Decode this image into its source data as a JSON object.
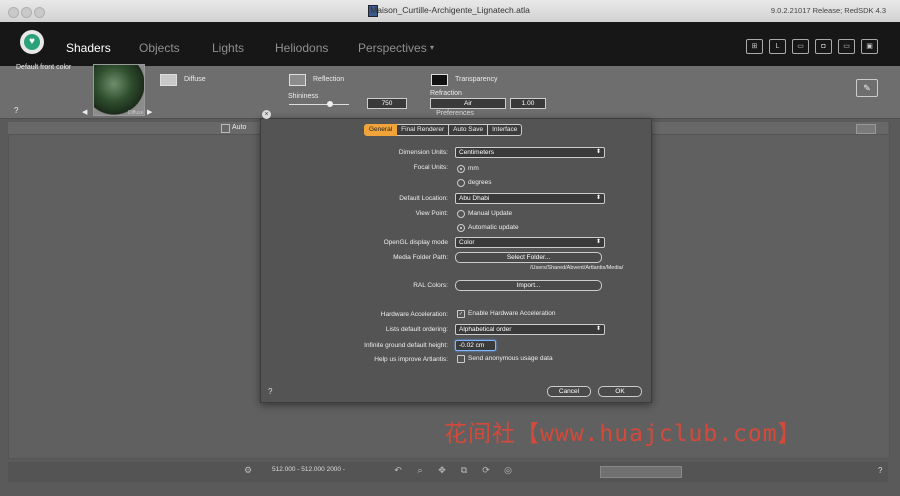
{
  "window": {
    "title": "Maison_Curtille-Archigente_Lignatech.atla",
    "version": "9.0.2.21017 Release; RedSDK 4.3"
  },
  "nav": {
    "items": [
      "Shaders",
      "Objects",
      "Lights",
      "Heliodons",
      "Perspectives"
    ],
    "perspectives_caret": "▾"
  },
  "shader": {
    "default_label": "Default front color",
    "help": "?",
    "thumb_caption": "Diffuse",
    "diffuse": "Diffuse",
    "reflection": "Reflection",
    "transparency": "Transparency",
    "shininess": "Shininess",
    "shininess_value": "750",
    "refraction": "Refraction",
    "refraction_select": "Air",
    "refraction_value": "1.00"
  },
  "viewport": {
    "auto": "Auto",
    "coords": "512.000 - 512.000 2000 -",
    "help": "?"
  },
  "dialog": {
    "title": "Preferences",
    "close": "×",
    "tabs": [
      "General",
      "Final Renderer",
      "Auto Save",
      "Interface"
    ],
    "active_tab": "General",
    "dimension_units_label": "Dimension Units:",
    "dimension_units_value": "Centimeters",
    "focal_units_label": "Focal Units:",
    "focal_mm": "mm",
    "focal_degrees": "degrees",
    "default_location_label": "Default Location:",
    "default_location_value": "Abu Dhabi",
    "view_point_label": "View Point:",
    "view_manual": "Manual Update",
    "view_auto": "Automatic update",
    "opengl_label": "OpenGL display mode",
    "opengl_value": "Color",
    "media_label": "Media Folder Path:",
    "media_button": "Select Folder...",
    "media_path": "/Users/Shared/Abvent/Artlantis/Media/",
    "ral_label": "RAL Colors:",
    "ral_button": "Import...",
    "hw_label": "Hardware Acceleration:",
    "hw_value": "Enable Hardware Acceleration",
    "lists_label": "Lists default ordering:",
    "lists_value": "Alphabetical order",
    "ground_label": "Infinite ground default height:",
    "ground_value": "-0.02 cm",
    "improve_label": "Help us improve Artlantis:",
    "improve_value": "Send anonymous usage data",
    "help": "?",
    "cancel": "Cancel",
    "ok": "OK"
  },
  "watermark": "花间社【www.huajclub.com】"
}
